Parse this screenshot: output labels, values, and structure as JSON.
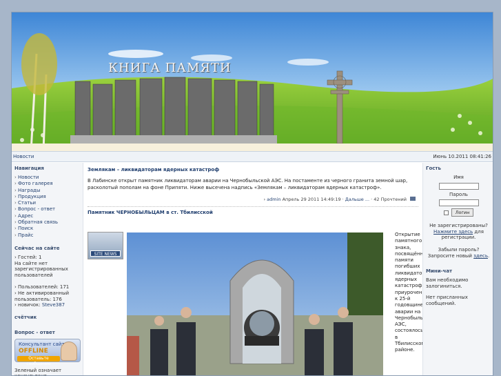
{
  "banner": {
    "title": "КНИГА ПАМЯТИ"
  },
  "navbar": {
    "link": "Новости",
    "date": "Июнь 10.2011 08:41:26"
  },
  "left": {
    "nav_title": "Навигация",
    "menu": [
      "Новости",
      "Фото галерея",
      "Награды",
      "Продукция",
      "Статьи",
      "Вопрос - ответ",
      "Адрес",
      "Обратная связь",
      "Поиск",
      "Прайс"
    ],
    "online_title": "Сейчас на сайте",
    "guests": "Гостей: 1",
    "no_users": "На сайте нет зарегистрированных пользователей",
    "users_count": "Пользователей: 171",
    "not_active": "Не активированный пользователь: 176",
    "newbie_label": "новичок:",
    "newbie_name": "Steve387",
    "counter_title": "счётчик",
    "qa_title": "Вопрос - ответ",
    "consult": {
      "line1": "Консультант сайта",
      "line2": "OFFLINE",
      "line3": "Оставьте сообщение"
    },
    "green_note": "Зеленый означает консультант"
  },
  "news": [
    {
      "title": "Землякам – ликвидаторам ядерных катастроф",
      "text": "В Лабинске открыт памятник ликвидаторам аварии на Чернобыльской АЭС. На постаменте из черного гранита земной шар, расколотый пополам на фоне Припяти. Ниже высечена надпись «Землякам – ликвидаторам ядерных катастроф».",
      "author": "admin",
      "date": "Апрель 29 2011 14:49:19",
      "more": "Дальше ...",
      "reads": "42 Прочтений"
    },
    {
      "title": "Памятник ЧЕРНОБЫЛЬЦАМ в ст. Тбилисской",
      "thumb_caption": "SITE NEWS",
      "side_text": "Открытие памятного знака, посвящённого памяти погибших ликвидаторов ядерных катастроф, приуроченное к 25-й годовщине аварии на Чернобыльской АЭС, состоялось в Тбилисском районе."
    }
  ],
  "right": {
    "guest_title": "Гость",
    "name_label": "Имя",
    "pass_label": "Пароль",
    "login_btn": "Логин",
    "not_reg": "Не зарегистрированы?",
    "click_here": "Нажмите здесь",
    "for_reg": "для регистрации.",
    "forgot": "Забыли пароль?",
    "request": "Запросите новый",
    "here": "здесь",
    "chat_title": "Мини-чат",
    "need_login": "Вам необходимо залогиниться.",
    "no_messages": "Нет присланных сообщений."
  }
}
